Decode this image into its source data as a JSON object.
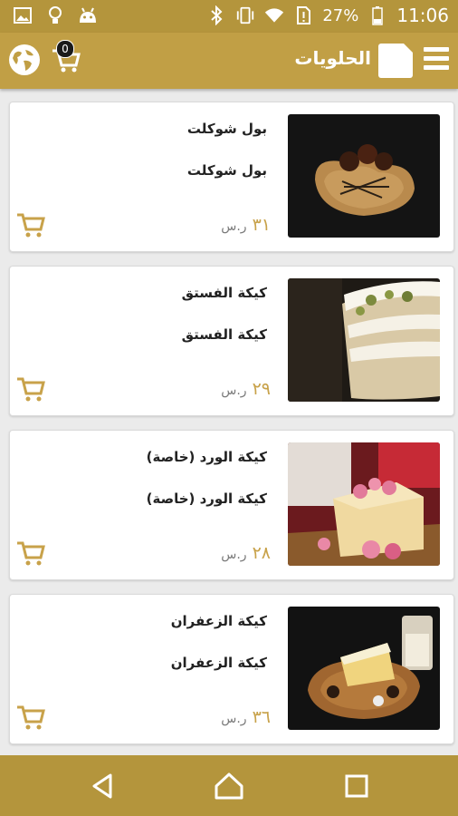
{
  "status_bar": {
    "battery_percent": "27%",
    "time": "11:06",
    "icons": [
      "image-icon",
      "lightbulb-icon",
      "android-icon",
      "bluetooth-icon",
      "vibrate-icon",
      "wifi-icon",
      "no-sim-icon",
      "battery-icon"
    ]
  },
  "app_bar": {
    "title": "الحلويات",
    "cart_count": "0",
    "icons": [
      "globe-icon",
      "cart-icon",
      "logo",
      "menu-icon"
    ]
  },
  "products": [
    {
      "name": "بول شوكلت",
      "description": "بول شوكلت",
      "price": "٣١",
      "currency": "ر.س",
      "image": "chocolate-balls-on-heart-board"
    },
    {
      "name": "كيكة الفستق",
      "description": "كيكة الفستق",
      "price": "٢٩",
      "currency": "ر.س",
      "image": "pistachio-cake"
    },
    {
      "name": "كيكة الورد (خاصة)",
      "description": "كيكة الورد (خاصة)",
      "price": "٢٨",
      "currency": "ر.س",
      "image": "rose-cake"
    },
    {
      "name": "كيكة الزعفران",
      "description": "كيكة الزعفران",
      "price": "٣٦",
      "currency": "ر.س",
      "image": "saffron-cake"
    }
  ],
  "colors": {
    "brand": "#c19f45",
    "price": "#c8a24a",
    "background": "#ebebeb"
  },
  "nav_bar": {
    "icons": [
      "back-icon",
      "home-icon",
      "recents-icon"
    ]
  }
}
